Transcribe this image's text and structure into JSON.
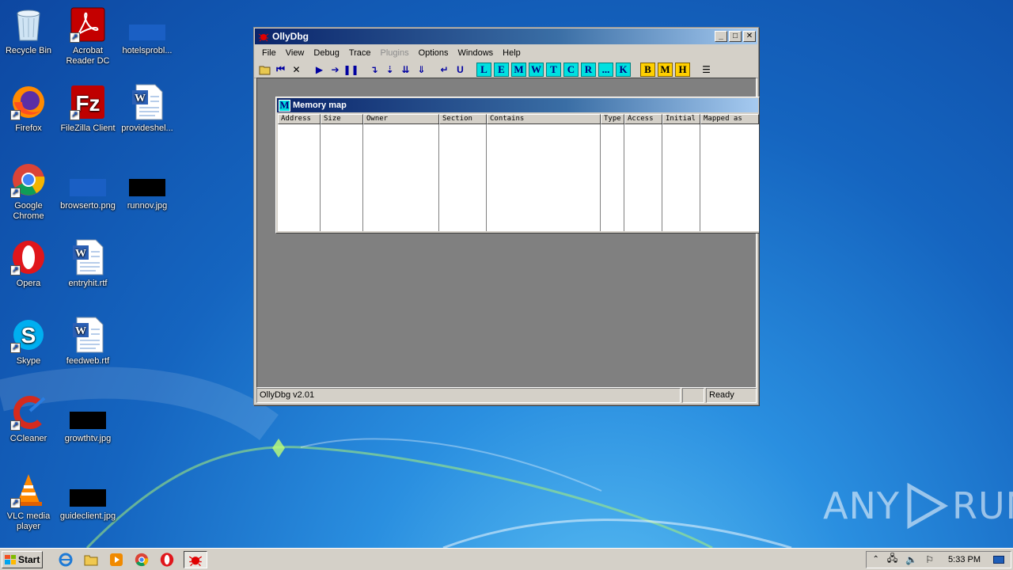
{
  "desktop": {
    "icons": [
      {
        "label": "Recycle Bin",
        "icon": "recycle-bin-icon"
      },
      {
        "label": "Acrobat Reader DC",
        "icon": "acrobat-icon"
      },
      {
        "label": "hotelsprobl...",
        "icon": "image-file-icon"
      },
      {
        "label": "Firefox",
        "icon": "firefox-icon"
      },
      {
        "label": "FileZilla Client",
        "icon": "filezilla-icon"
      },
      {
        "label": "provideshel...",
        "icon": "word-doc-icon"
      },
      {
        "label": "Google Chrome",
        "icon": "chrome-icon"
      },
      {
        "label": "browserto.png",
        "icon": "image-file-icon"
      },
      {
        "label": "runnov.jpg",
        "icon": "image-file-icon"
      },
      {
        "label": "Opera",
        "icon": "opera-icon"
      },
      {
        "label": "entryhit.rtf",
        "icon": "word-doc-icon"
      },
      {
        "label": "Skype",
        "icon": "skype-icon"
      },
      {
        "label": "feedweb.rtf",
        "icon": "word-doc-icon"
      },
      {
        "label": "CCleaner",
        "icon": "ccleaner-icon"
      },
      {
        "label": "growthtv.jpg",
        "icon": "image-file-icon"
      },
      {
        "label": "VLC media player",
        "icon": "vlc-icon"
      },
      {
        "label": "guideclient.jpg",
        "icon": "image-file-icon"
      }
    ]
  },
  "olly": {
    "title": "OllyDbg",
    "menu": [
      "File",
      "View",
      "Debug",
      "Trace",
      "Plugins",
      "Options",
      "Windows",
      "Help"
    ],
    "menu_disabled": [
      "Plugins"
    ],
    "toolbar_letters": [
      "L",
      "E",
      "M",
      "W",
      "T",
      "C",
      "R",
      "...",
      "K"
    ],
    "toolbar_yellow": [
      "B",
      "M",
      "H"
    ],
    "memory_map": {
      "title": "Memory map",
      "icon_letter": "M",
      "columns": [
        "Address",
        "Size",
        "Owner",
        "Section",
        "Contains",
        "Type",
        "Access",
        "Initial",
        "Mapped as"
      ]
    },
    "status": {
      "version": "OllyDbg v2.01",
      "middle": "",
      "state": "Ready"
    }
  },
  "taskbar": {
    "start_label": "Start",
    "clock": "5:33 PM"
  },
  "watermark": {
    "text_left": "ANY",
    "text_right": "RUN"
  }
}
